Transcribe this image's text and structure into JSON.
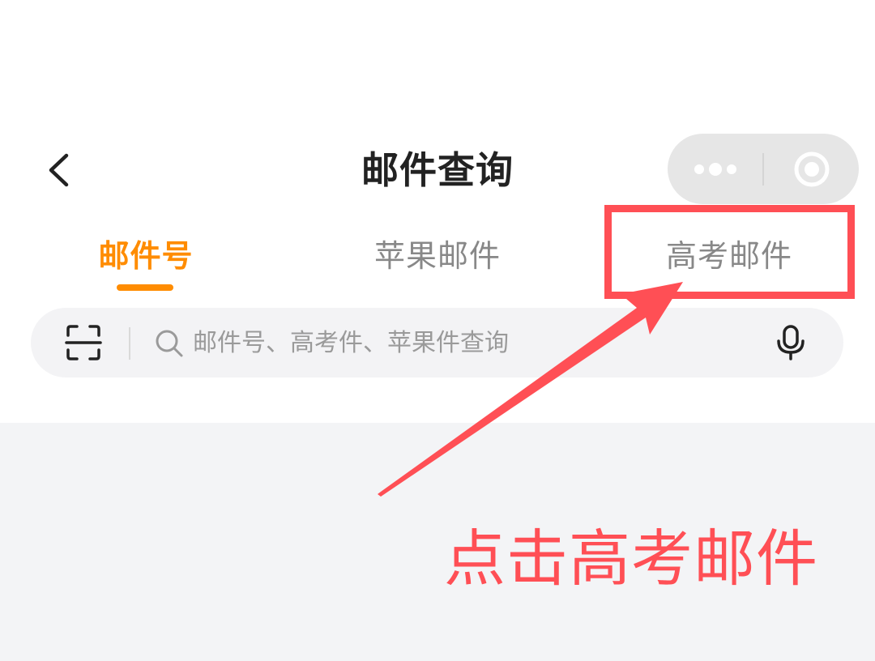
{
  "header": {
    "title": "邮件查询",
    "back_icon": "chevron-left-icon",
    "more_icon": "more-dots-icon",
    "close_icon": "target-close-icon"
  },
  "tabs": [
    {
      "label": "邮件号",
      "active": true
    },
    {
      "label": "苹果邮件",
      "active": false
    },
    {
      "label": "高考邮件",
      "active": false
    }
  ],
  "search": {
    "placeholder": "邮件号、高考件、苹果件查询",
    "value": "",
    "scan_icon": "scan-icon",
    "search_icon": "search-icon",
    "mic_icon": "microphone-icon"
  },
  "annotation": {
    "text": "点击高考邮件",
    "color": "#ff4f55"
  },
  "colors": {
    "accent": "#ff8c00",
    "annotation": "#ff4f55",
    "title": "#222222",
    "inactive_tab": "#888888"
  }
}
